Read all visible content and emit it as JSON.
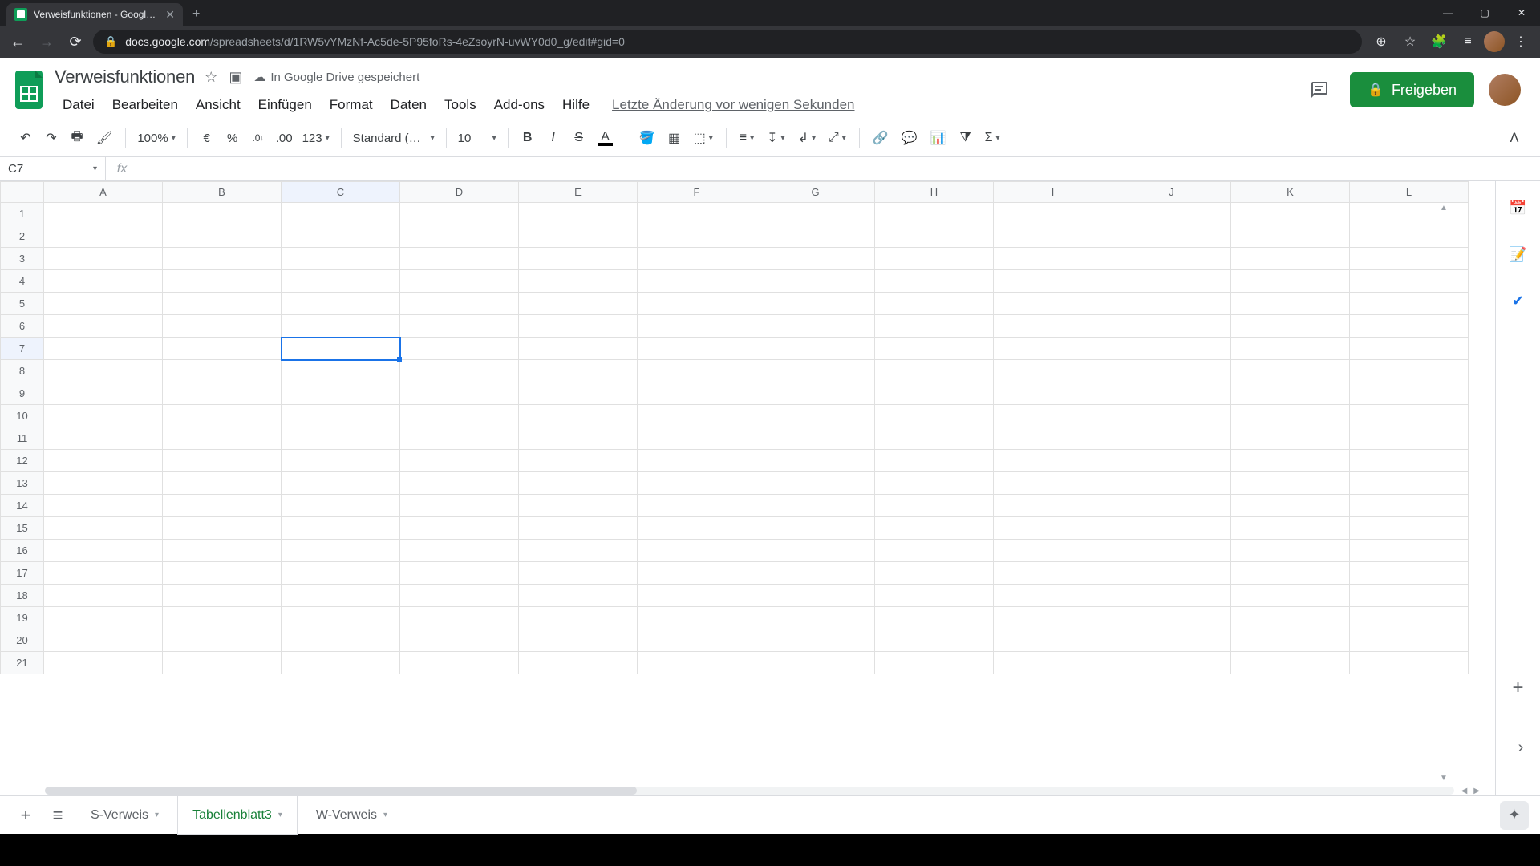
{
  "browser": {
    "tab_title": "Verweisfunktionen - Google Tab…",
    "url_host": "docs.google.com",
    "url_path": "/spreadsheets/d/1RW5vYMzNf-Ac5de-5P95foRs-4eZsoyrN-uvWY0d0_g/edit#gid=0"
  },
  "doc": {
    "title": "Verweisfunktionen",
    "drive_status": "In Google Drive gespeichert",
    "history": "Letzte Änderung vor wenigen Sekunden"
  },
  "menu": {
    "file": "Datei",
    "edit": "Bearbeiten",
    "view": "Ansicht",
    "insert": "Einfügen",
    "format": "Format",
    "data": "Daten",
    "tools": "Tools",
    "addons": "Add-ons",
    "help": "Hilfe"
  },
  "share": {
    "label": "Freigeben"
  },
  "toolbar": {
    "zoom": "100%",
    "currency": "€",
    "percent": "%",
    "dec_dec": ".0",
    "inc_dec": ".00",
    "numfmt": "123",
    "font": "Standard (…",
    "font_size": "10"
  },
  "namebox": {
    "cell": "C7"
  },
  "columns": [
    "A",
    "B",
    "C",
    "D",
    "E",
    "F",
    "G",
    "H",
    "I",
    "J",
    "K",
    "L"
  ],
  "rows": [
    "1",
    "2",
    "3",
    "4",
    "5",
    "6",
    "7",
    "8",
    "9",
    "10",
    "11",
    "12",
    "13",
    "14",
    "15",
    "16",
    "17",
    "18",
    "19",
    "20",
    "21"
  ],
  "selected": {
    "col": "C",
    "row": "7"
  },
  "sheet_tabs": {
    "sverweis": "S-Verweis",
    "tabellenblatt3": "Tabellenblatt3",
    "wverweis": "W-Verweis"
  }
}
